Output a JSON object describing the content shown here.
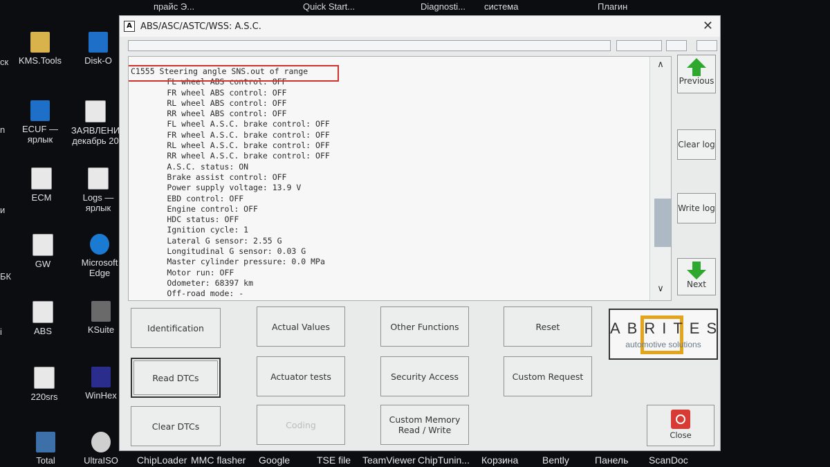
{
  "desktop": {
    "top_labels": [
      "прайс Э...",
      "Quick Start...",
      "Diagnosti...",
      "система",
      "Плагин"
    ],
    "left_edge_labels": [
      "ск",
      "n",
      "и",
      "БК",
      "i"
    ],
    "icons": [
      {
        "label": "KMS.Tools",
        "icon": "folder-icon"
      },
      {
        "label": "Disk-O",
        "icon": "disk-icon"
      },
      {
        "label": "ECUF — ярлык",
        "icon": "ecu-icon"
      },
      {
        "label": "ЗАЯВЛЕНИ декабрь 20",
        "icon": "document-icon"
      },
      {
        "label": "ECM",
        "icon": "document-icon"
      },
      {
        "label": "Logs — ярлык",
        "icon": "document-icon"
      },
      {
        "label": "GW",
        "icon": "document-icon"
      },
      {
        "label": "Microsoft Edge",
        "icon": "edge-icon"
      },
      {
        "label": "ABS",
        "icon": "document-icon"
      },
      {
        "label": "KSuite",
        "icon": "ksuite-icon"
      },
      {
        "label": "220srs",
        "icon": "document-icon"
      },
      {
        "label": "WinHex",
        "icon": "hex-icon"
      },
      {
        "label": "Total",
        "icon": "disk-icon"
      },
      {
        "label": "UltraISO",
        "icon": "cd-icon"
      }
    ],
    "taskbar": [
      "ChipLoader",
      "MMC flasher",
      "Google",
      "TSE file",
      "TeamViewer",
      "ChipTunin...",
      "Корзина",
      "Bently",
      "Панель",
      "ScanDoc"
    ]
  },
  "window": {
    "title": "ABS/ASC/ASTC/WSS: A.S.C.",
    "app_icon_letter": "A",
    "close_glyph": "✕"
  },
  "log": {
    "highlighted_line": "C1555 Steering angle SNS.out of range",
    "lines": [
      "        FL wheel ABS control: OFF",
      "        FR wheel ABS control: OFF",
      "        RL wheel ABS control: OFF",
      "        RR wheel ABS control: OFF",
      "        FL wheel A.S.C. brake control: OFF",
      "        FR wheel A.S.C. brake control: OFF",
      "        RL wheel A.S.C. brake control: OFF",
      "        RR wheel A.S.C. brake control: OFF",
      "        A.S.C. status: ON",
      "        Brake assist control: OFF",
      "        Power supply voltage: 13.9 V",
      "        EBD control: OFF",
      "        Engine control: OFF",
      "        HDC status: OFF",
      "        Ignition cycle: 1",
      "        Lateral G sensor: 2.55 G",
      "        Longitudinal G sensor: 0.03 G",
      "        Master cylinder pressure: 0.0 MPa",
      "        Motor run: OFF",
      "        Odometer: 68397 km",
      "        Off-road mode: -"
    ],
    "highlight_color": "#d0312d"
  },
  "side_buttons": {
    "previous": "Previous",
    "clear_log": "Clear log",
    "write_log": "Write log",
    "next": "Next"
  },
  "function_buttons": {
    "identification": "Identification",
    "actual_values": "Actual Values",
    "other_functions": "Other Functions",
    "reset": "Reset",
    "read_dtcs": "Read DTCs",
    "actuator_tests": "Actuator tests",
    "security_access": "Security Access",
    "custom_request": "Custom Request",
    "clear_dtcs": "Clear DTCs",
    "coding": "Coding",
    "custom_memory": "Custom Memory Read / Write"
  },
  "logo": {
    "word": "ABRITES",
    "subtitle": "automotive solutions",
    "accent": "#e2a51b"
  },
  "close_button": {
    "label": "Close",
    "color": "#d73b33"
  }
}
